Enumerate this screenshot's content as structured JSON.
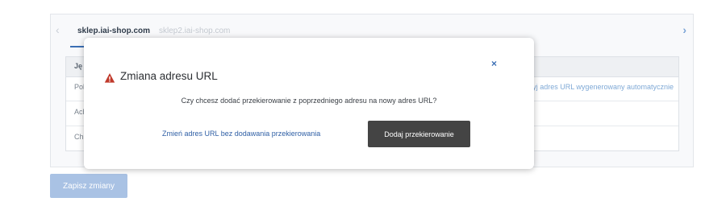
{
  "tabs": {
    "prev_arrow": "‹",
    "next_arrow": "›",
    "active": "sklep.iai-shop.com",
    "inactive": "sklep2.iai-shop.com"
  },
  "table": {
    "header_first": "Ję",
    "rows": [
      {
        "lang": "Pol",
        "link": "Użyj adres URL wygenerowany automatycznie"
      },
      {
        "lang": "Ach",
        "link": ""
      },
      {
        "lang": "Chi",
        "link": ""
      }
    ]
  },
  "save_button": "Zapisz zmiany",
  "modal": {
    "title": "Zmiana adresu URL",
    "close_symbol": "×",
    "question": "Czy chcesz dodać przekierowanie z poprzedniego adresu na nowy adres URL?",
    "secondary_action": "Zmień adres URL bez dodawania przekierowania",
    "primary_action": "Dodaj przekierowanie"
  },
  "colors": {
    "accent": "#3b6fb5",
    "warning": "#c0392b",
    "primary_button": "#444444",
    "save_button": "#a9c2e4"
  },
  "icons": {
    "warning": "warning-triangle-icon",
    "close": "close-icon",
    "prev": "chevron-left-icon",
    "next": "chevron-right-icon"
  }
}
